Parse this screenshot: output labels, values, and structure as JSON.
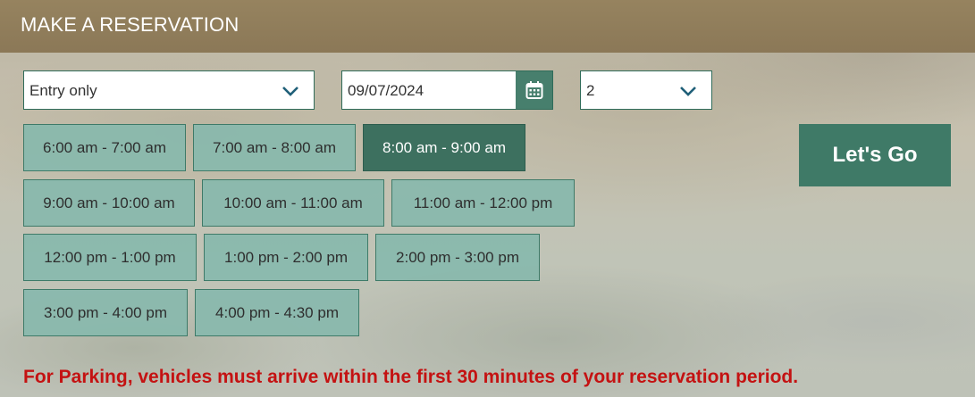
{
  "header": {
    "title": "MAKE A RESERVATION"
  },
  "form": {
    "type_select": {
      "value": "Entry only",
      "icon": "chevron-down-icon"
    },
    "date_field": {
      "value": "09/07/2024",
      "icon": "calendar-icon"
    },
    "guests_select": {
      "value": "2",
      "icon": "chevron-down-icon"
    }
  },
  "time_slots": [
    {
      "label": "6:00 am - 7:00 am",
      "selected": false
    },
    {
      "label": "7:00 am - 8:00 am",
      "selected": false
    },
    {
      "label": "8:00 am - 9:00 am",
      "selected": true
    },
    {
      "label": "9:00 am - 10:00 am",
      "selected": false
    },
    {
      "label": "10:00 am - 11:00 am",
      "selected": false
    },
    {
      "label": "11:00 am - 12:00 pm",
      "selected": false
    },
    {
      "label": "12:00 pm - 1:00 pm",
      "selected": false
    },
    {
      "label": "1:00 pm - 2:00 pm",
      "selected": false
    },
    {
      "label": "2:00 pm - 3:00 pm",
      "selected": false
    },
    {
      "label": "3:00 pm - 4:00 pm",
      "selected": false
    },
    {
      "label": "4:00 pm - 4:30 pm",
      "selected": false
    }
  ],
  "submit": {
    "label": "Let's Go"
  },
  "notice": {
    "text": "For Parking, vehicles must arrive within the first 30 minutes of your reservation period."
  },
  "colors": {
    "header_bg": "#8f7c5a",
    "accent_green": "#3f7a67",
    "slot_bg": "#88b8ac",
    "notice_red": "#c41212"
  }
}
